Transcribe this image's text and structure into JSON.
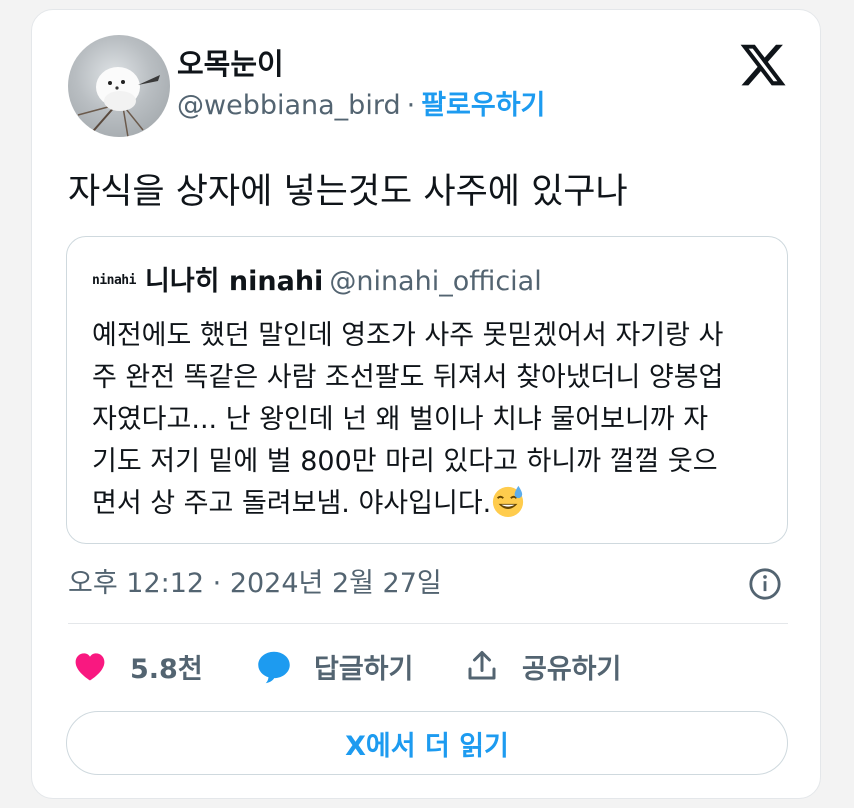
{
  "author": {
    "display_name": "오목눈이",
    "handle": "@webbiana_bird",
    "separator": "·",
    "follow_label": "팔로우하기",
    "avatar_icon": "bird-avatar"
  },
  "brand_icon": "x-logo-icon",
  "tweet": {
    "text": "자식을 상자에 넣는것도 사주에 있구나"
  },
  "quote": {
    "logo_text": "ninahi",
    "name": "니나히 ninahi",
    "handle": "@ninahi_official",
    "lines": [
      "예전에도 했던 말인데 영조가 사주 못믿겠어서 자기랑 사",
      "주 완전 똑같은 사람 조선팔도 뒤져서 찾아냈더니 양봉업",
      "자였다고... 난 왕인데 넌 왜 벌이나 치냐 물어보니까 자",
      "기도 저기 밑에 벌 800만 마리 있다고 하니까 껄껄 웃으",
      "면서 상 주고 돌려보냄. 야사입니다."
    ],
    "emoji_icon": "sweat-smile-emoji"
  },
  "meta": {
    "timestamp": "오후 12:12 · 2024년 2월 27일",
    "info_icon": "info-icon"
  },
  "actions": {
    "like_count": "5.8천",
    "reply_label": "답글하기",
    "share_label": "공유하기"
  },
  "read_more_label": "X에서 더 읽기",
  "colors": {
    "accent": "#1d9bf0",
    "like": "#f91880",
    "text": "#0f1419",
    "secondary": "#536471",
    "border": "#cfd9de"
  }
}
